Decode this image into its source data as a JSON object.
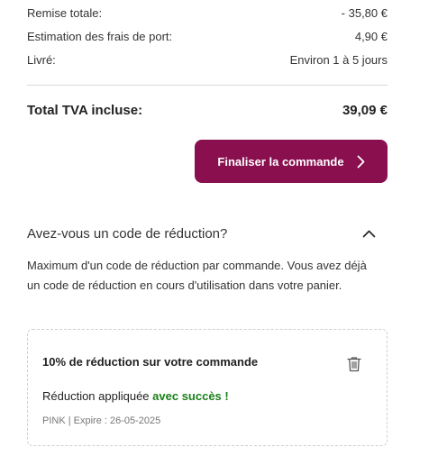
{
  "summary": {
    "rows": [
      {
        "label": "Remise totale:",
        "value": "- 35,80 €"
      },
      {
        "label": "Estimation des frais de port:",
        "value": "4,90 €"
      },
      {
        "label": "Livré:",
        "value": "Environ 1 à 5 jours"
      }
    ],
    "total_label": "Total TVA incluse:",
    "total_value": "39,09 €"
  },
  "checkout": {
    "button_label": "Finaliser la commande",
    "accent_color": "#8a0f4f"
  },
  "coupon_section": {
    "heading": "Avez-vous un code de réduction?",
    "expanded": true,
    "description": "Maximum d'un code de réduction par commande. Vous avez déjà un code de réduction en cours d'utilisation dans votre panier.",
    "applied": {
      "title": "10% de réduction sur votre commande",
      "status_prefix": "Réduction appliquée ",
      "status_success": "avec succès !",
      "success_color": "#1a7f1a",
      "meta": "PINK | Expire : 26-05-2025",
      "remove_icon": "trash-icon"
    }
  }
}
